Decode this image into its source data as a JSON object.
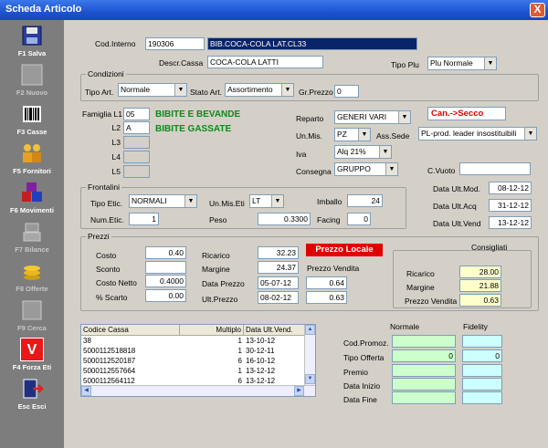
{
  "window": {
    "title": "Scheda Articolo",
    "close_label": "X"
  },
  "sidebar": {
    "items": [
      {
        "label": "F1 Salva"
      },
      {
        "label": "F2 Nuovo"
      },
      {
        "label": "F3 Casse"
      },
      {
        "label": "F5 Fornitori"
      },
      {
        "label": "F6 Movimenti"
      },
      {
        "label": "F7 Bilance"
      },
      {
        "label": "F8 Offerte"
      },
      {
        "label": "F9 Cerca"
      },
      {
        "label": "F4 Forza Eti",
        "icon_text": "V"
      },
      {
        "label": "Esc Esci"
      }
    ]
  },
  "header": {
    "cod_interno_label": "Cod.Interno",
    "cod_interno_value": "190306",
    "desc_value": "BIB.COCA-COLA LAT.CL33",
    "descr_cassa_label": "Descr.Cassa",
    "descr_cassa_value": "COCA-COLA LATTI",
    "tipo_plu_label": "Tipo Plu",
    "tipo_plu_value": "Plu Normale"
  },
  "condizioni": {
    "title": "Condizioni",
    "tipo_art_label": "Tipo Art.",
    "tipo_art_value": "Normale",
    "stato_art_label": "Stato Art.",
    "stato_art_value": "Assortimento",
    "gr_prezzo_label": "Gr.Prezzo",
    "gr_prezzo_value": "0"
  },
  "famiglia": {
    "l1_label": "Famiglia L1",
    "l1_value": "05",
    "l1_desc": "BIBITE E BEVANDE",
    "l2_label": "L2",
    "l2_value": "A",
    "l2_desc": "BIBITE GASSATE",
    "l3_label": "L3",
    "l4_label": "L4",
    "l5_label": "L5"
  },
  "reparto": {
    "reparto_label": "Reparto",
    "reparto_value": "GENERI VARI",
    "can_secco": "Can.->Secco",
    "unmis_label": "Un.Mis.",
    "unmis_value": "PZ",
    "ass_sede_label": "Ass.Sede",
    "ass_sede_value": "PL-prod. leader insostituibili",
    "iva_label": "Iva",
    "iva_value": "Alq 21%",
    "consegna_label": "Consegna",
    "consegna_value": "GRUPPO",
    "cvuoto_label": "C.Vuoto",
    "cvuoto_value": ""
  },
  "frontalini": {
    "title": "Frontalini",
    "tipo_etic_label": "Tipo Etic.",
    "tipo_etic_value": "NORMALI",
    "unmis_eti_label": "Un.Mis.Eti",
    "unmis_eti_value": "LT",
    "imballo_label": "Imballo",
    "imballo_value": "24",
    "num_etic_label": "Num.Etic.",
    "num_etic_value": "1",
    "peso_label": "Peso",
    "peso_value": "0.3300",
    "facing_label": "Facing",
    "facing_value": "0"
  },
  "dates": {
    "mod_label": "Data Ult.Mod.",
    "mod_value": "08-12-12",
    "acq_label": "Data Ult.Acq",
    "acq_value": "31-12-12",
    "vend_label": "Data Ult.Vend",
    "vend_value": "13-12-12"
  },
  "prezzi": {
    "title": "Prezzi",
    "costo_label": "Costo",
    "costo_value": "0.40",
    "sconto_label": "Sconto",
    "sconto_value": "",
    "costo_netto_label": "Costo Netto",
    "costo_netto_value": "0.4000",
    "scarto_label": "% Scarto",
    "scarto_value": "0.00",
    "ricarico_label": "Ricarico",
    "ricarico_value": "32.23",
    "margine_label": "Margine",
    "margine_value": "24.37",
    "data_prezzo_label": "Data Prezzo",
    "data_prezzo_value": "05-07-12",
    "ult_prezzo_label": "Ult.Prezzo",
    "ult_prezzo_value": "08-02-12",
    "prezzo_locale": "Prezzo Locale",
    "prezzo_vendita_label": "Prezzo Vendita",
    "pv_value_1": "0.64",
    "pv_value_2": "0.63"
  },
  "consigliati": {
    "title": "Consigliati",
    "ricarico_label": "Ricarico",
    "ricarico_value": "28.00",
    "margine_label": "Margine",
    "margine_value": "21.88",
    "pv_label": "Prezzo Vendita",
    "pv_value": "0.63"
  },
  "list": {
    "headers": [
      "Codice Cassa",
      "Multiplo",
      "Data Ult.Vend."
    ],
    "rows": [
      [
        "38",
        "1",
        "13-10-12"
      ],
      [
        "5000112518818",
        "1",
        "30-12-11"
      ],
      [
        "5000112520187",
        "6",
        "16-10-12"
      ],
      [
        "5000112557664",
        "1",
        "13-12-12"
      ],
      [
        "5000112564112",
        "6",
        "13-12-12"
      ]
    ]
  },
  "promo": {
    "normale_label": "Normale",
    "fidelity_label": "Fidelity",
    "cod_promoz_label": "Cod.Promoz.",
    "tipo_offerta_label": "Tipo Offerta",
    "tipo_offerta_normale": "0",
    "tipo_offerta_fidelity": "0",
    "premio_label": "Premio",
    "data_inizio_label": "Data Inizio",
    "data_fine_label": "Data Fine"
  }
}
